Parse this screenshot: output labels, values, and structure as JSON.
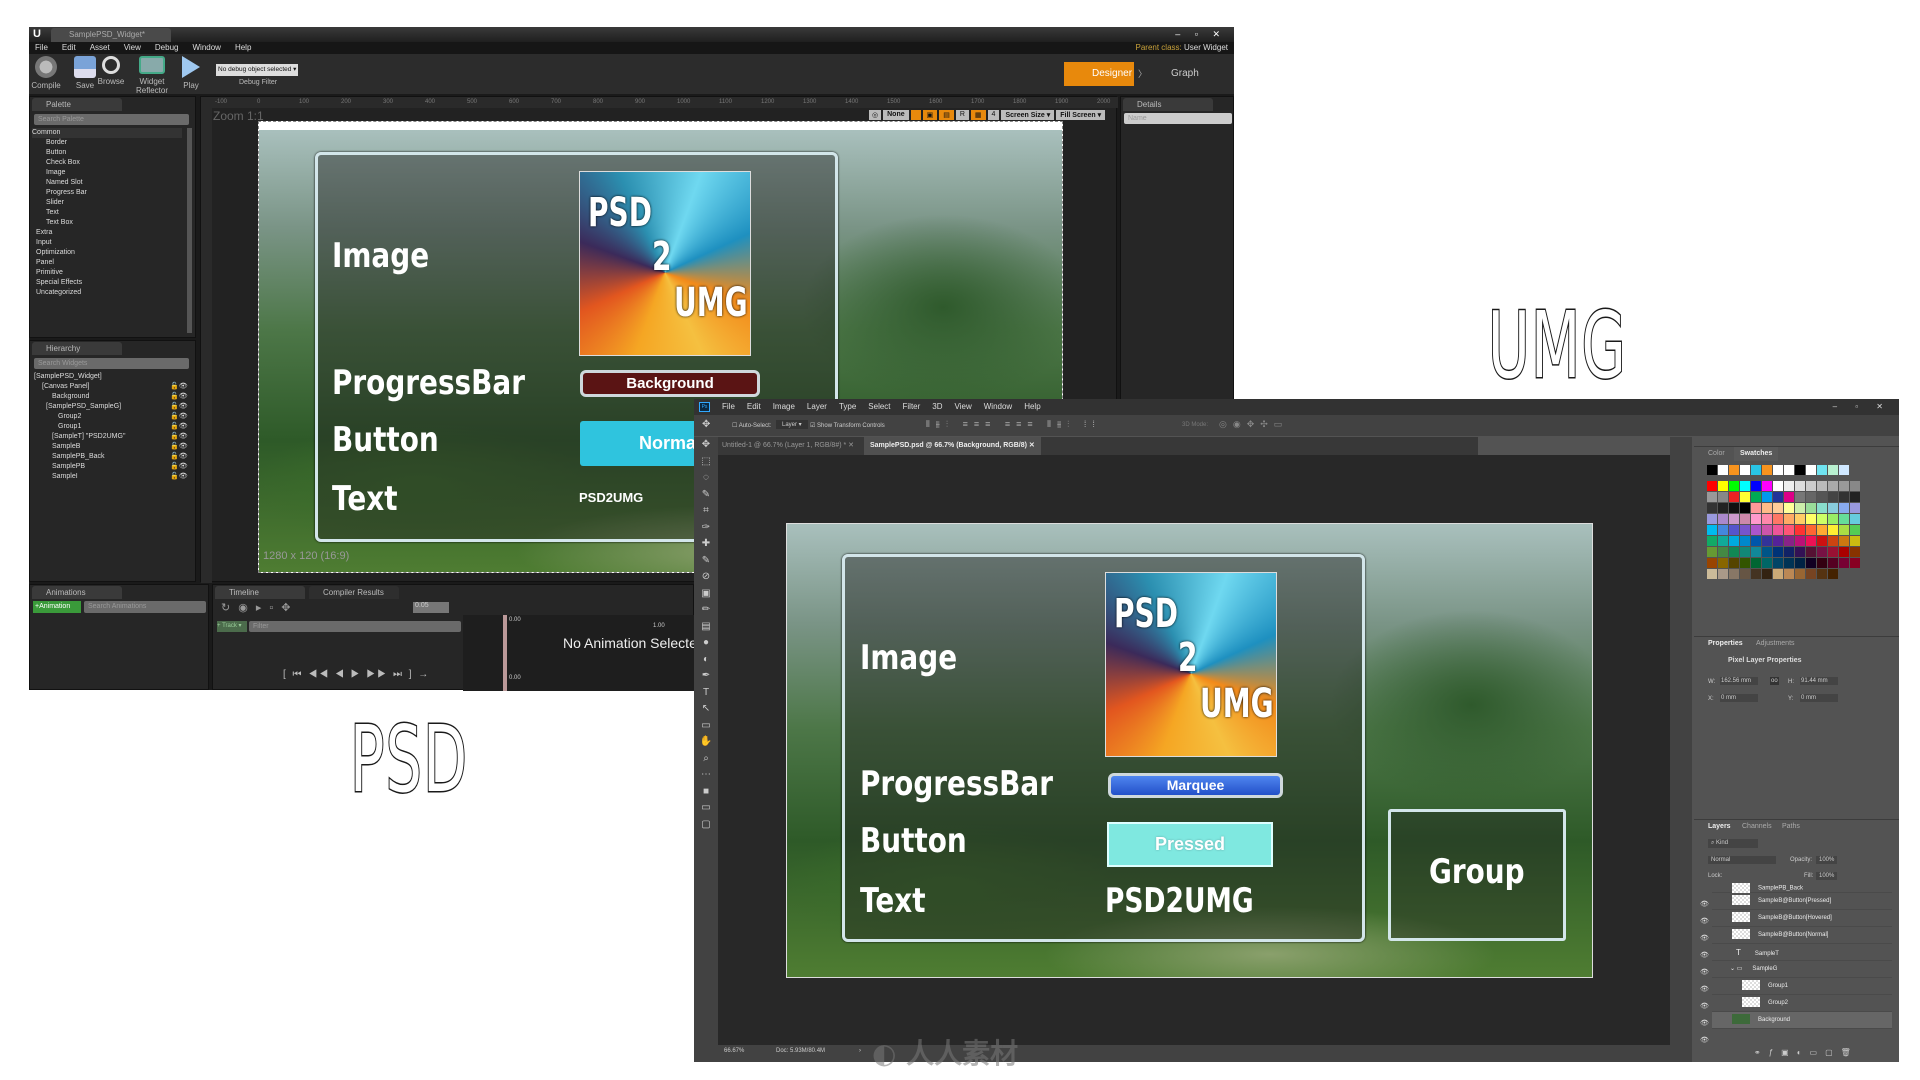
{
  "labels": {
    "psd": "PSD",
    "umg": "UMG"
  },
  "watermark_logo": "人人素材",
  "ue": {
    "tab_title": "SamplePSD_Widget*",
    "menu": [
      "File",
      "Edit",
      "Asset",
      "View",
      "Debug",
      "Window",
      "Help"
    ],
    "toolbar": {
      "compile": "Compile",
      "save": "Save",
      "browse": "Browse",
      "widget_reflector": "Widget Reflector",
      "play": "Play",
      "debug_object": "No debug object selected ▾",
      "debug_filter": "Debug Filter"
    },
    "parent_class_label": "Parent class:",
    "parent_class": "User Widget",
    "designer": "Designer",
    "graph": "Graph",
    "palette": {
      "tab": "Palette",
      "search": "Search Palette",
      "common": "Common",
      "items": [
        "Border",
        "Button",
        "Check Box",
        "Image",
        "Named Slot",
        "Progress Bar",
        "Slider",
        "Text",
        "Text Box"
      ],
      "categories": [
        "Extra",
        "Input",
        "Optimization",
        "Panel",
        "Primitive",
        "Special Effects",
        "Uncategorized"
      ]
    },
    "hierarchy": {
      "tab": "Hierarchy",
      "search": "Search Widgets",
      "items": [
        "[SamplePSD_Widget]",
        "[Canvas Panel]",
        "Background",
        "[SamplePSD_SampleG]",
        "Group2",
        "Group1",
        "[SampleT] \"PSD2UMG\"",
        "SampleB",
        "SamplePB_Back",
        "SamplePB",
        "SampleI"
      ]
    },
    "viewport": {
      "zoom": "Zoom 1:1",
      "resolution": "1280 x 120 (16:9)",
      "none": "None",
      "r": "R",
      "grid": "4",
      "screen_size": "Screen Size ▾",
      "fill_screen": "Fill Screen ▾",
      "ruler": [
        "-100",
        "0",
        "100",
        "200",
        "300",
        "400",
        "500",
        "600",
        "700",
        "800",
        "900",
        "1000",
        "1100",
        "1200",
        "1300",
        "1400",
        "1500",
        "1600",
        "1700",
        "1800",
        "1900",
        "2000"
      ]
    },
    "details": {
      "tab": "Details",
      "name_placeholder": "Name"
    },
    "widget": {
      "image_label": "Image",
      "progress_label": "ProgressBar",
      "button_label": "Button",
      "text_label": "Text",
      "progress_text": "Background",
      "button_text": "Normal",
      "text_value": "PSD2UMG",
      "img_l1": "PSD",
      "img_l2": "2",
      "img_l3": "UMG"
    },
    "animations": {
      "tab": "Animations",
      "add": "+Animation",
      "search": "Search Animations"
    },
    "timeline": {
      "tab": "Timeline",
      "compiler_tab": "Compiler Results",
      "track": "+ Track ▾",
      "filter": "Filter",
      "step": "0.05",
      "t0": "0.00",
      "t1": "1.00",
      "no_anim": "No Animation Selected"
    }
  },
  "ps": {
    "menu": [
      "File",
      "Edit",
      "Image",
      "Layer",
      "Type",
      "Select",
      "Filter",
      "3D",
      "View",
      "Window",
      "Help"
    ],
    "options": {
      "auto_select": "Auto-Select:",
      "layer": "Layer ▾",
      "show_transform": "Show Transform Controls",
      "mode3d": "3D Mode:"
    },
    "tabs": [
      "Untitled-1 @ 66.7% (Layer 1, RGB/8#) *",
      "SamplePSD.psd @ 66.7% (Background, RGB/8)"
    ],
    "doc": {
      "image_label": "Image",
      "progress_label": "ProgressBar",
      "button_label": "Button",
      "text_label": "Text",
      "progress_text": "Marquee",
      "button_text": "Pressed",
      "text_value": "PSD2UMG",
      "group": "Group",
      "img_l1": "PSD",
      "img_l2": "2",
      "img_l3": "UMG"
    },
    "swatches": {
      "tabs": [
        "Color",
        "Swatches"
      ]
    },
    "properties": {
      "tabs": [
        "Properties",
        "Adjustments"
      ],
      "title": "Pixel Layer Properties",
      "w_label": "W:",
      "w": "162.56 mm",
      "h_label": "H:",
      "h": "91.44 mm",
      "x_label": "X:",
      "x": "0 mm",
      "y_label": "Y:",
      "y": "0 mm"
    },
    "layers": {
      "tabs": [
        "Layers",
        "Channels",
        "Paths"
      ],
      "kind": "Kind",
      "blend": "Normal",
      "opacity_label": "Opacity:",
      "opacity": "100%",
      "lock_label": "Lock:",
      "fill_label": "Fill:",
      "fill": "100%",
      "items": [
        "SamplePB_Back",
        "SampleB@Button[Pressed]",
        "SampleB@Button[Hovered]",
        "SampleB@Button[Normal]",
        "SampleT",
        "SampleG",
        "Group1",
        "Group2",
        "Background"
      ]
    },
    "status": {
      "zoom": "66.67%",
      "doc": "Doc: 5.93M/80.4M"
    }
  },
  "colors": {
    "ue_accent": "#e8890c",
    "progress_bg": "#5a1414",
    "button_normal": "#2fc4de",
    "marquee": "#2f63e0",
    "pressed": "#7fe8e0"
  }
}
